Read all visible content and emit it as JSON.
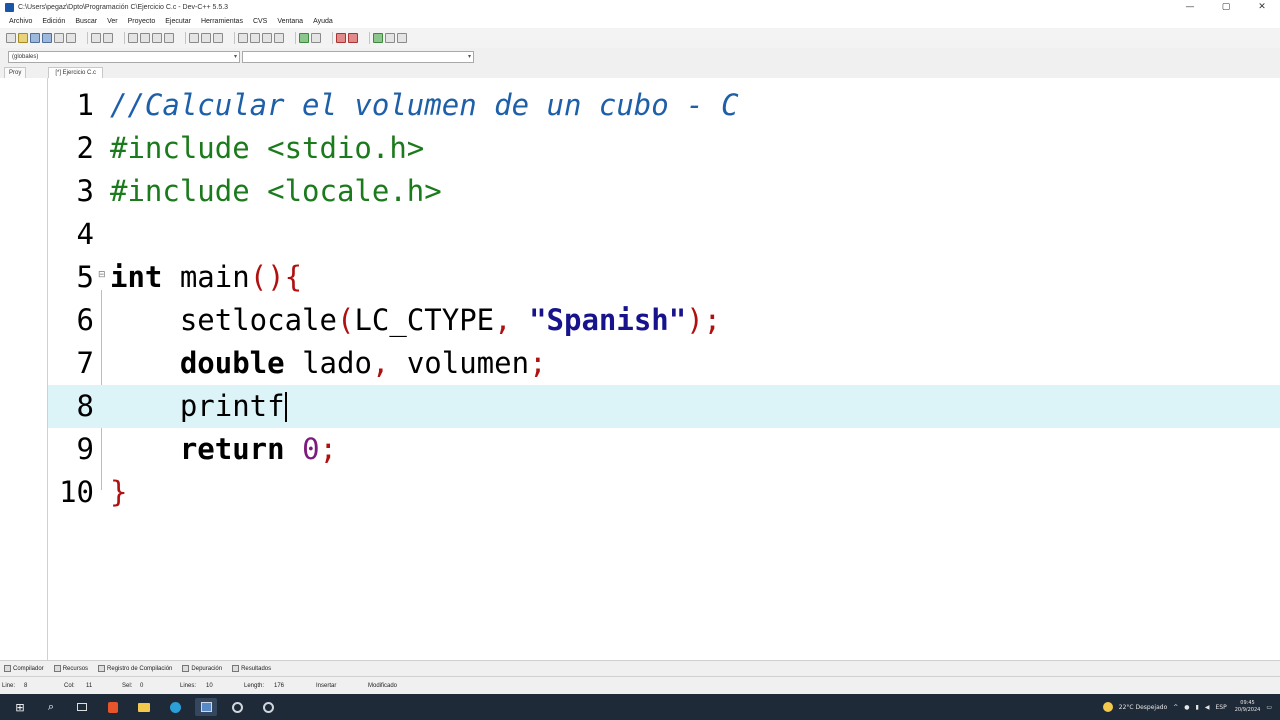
{
  "window": {
    "title": "C:\\Users\\pegaz\\Dpto\\Programación C\\Ejercicio C.c - Dev-C++ 5.5.3",
    "minimize_glyph": "—",
    "maximize_glyph": "▢",
    "close_glyph": "✕"
  },
  "menu": {
    "items": [
      {
        "label": "Archivo"
      },
      {
        "label": "Edición"
      },
      {
        "label": "Buscar"
      },
      {
        "label": "Ver"
      },
      {
        "label": "Proyecto"
      },
      {
        "label": "Ejecutar"
      },
      {
        "label": "Herramientas"
      },
      {
        "label": "CVS"
      },
      {
        "label": "Ventana"
      },
      {
        "label": "Ayuda"
      }
    ]
  },
  "toolbar2": {
    "compiler_select": "(globales)",
    "arrow_glyph": "▾"
  },
  "tabs": {
    "side_tab": "Proy",
    "file_tab": "[*] Ejercicio C.c"
  },
  "editor": {
    "lines": [
      {
        "num": "1"
      },
      {
        "num": "2"
      },
      {
        "num": "3"
      },
      {
        "num": "4"
      },
      {
        "num": "5"
      },
      {
        "num": "6"
      },
      {
        "num": "7"
      },
      {
        "num": "8"
      },
      {
        "num": "9"
      },
      {
        "num": "10"
      }
    ],
    "code": {
      "l1_comment": "//Calcular el volumen de un cubo - C",
      "l2_pre": "#include <stdio.h>",
      "l3_pre": "#include <locale.h>",
      "l5_kw": "int",
      "l5_name": " main",
      "l5_paren": "()",
      "l5_brace": "{",
      "l6_indent": "    ",
      "l6_func": "setlocale",
      "l6_open": "(",
      "l6_arg": "LC_CTYPE",
      "l6_comma": ", ",
      "l6_str": "\"Spanish\"",
      "l6_close": ");",
      "l7_indent": "    ",
      "l7_kw": "double",
      "l7_var1": " lado",
      "l7_comma": ", ",
      "l7_var2": "volumen",
      "l7_semi": ";",
      "l8_indent": "    ",
      "l8_func": "printf",
      "l9_indent": "    ",
      "l9_kw": "return",
      "l9_space": " ",
      "l9_num": "0",
      "l9_semi": ";",
      "l10_brace": "}"
    },
    "fold_glyph": "⊟"
  },
  "bottom_tabs": [
    {
      "label": "Compilador"
    },
    {
      "label": "Recursos"
    },
    {
      "label": "Registro de Compilación"
    },
    {
      "label": "Depuración"
    },
    {
      "label": "Resultados"
    }
  ],
  "status": {
    "line_label": "Line:",
    "line_value": "8",
    "col_label": "Col:",
    "col_value": "11",
    "sel_label": "Sel:",
    "sel_value": "0",
    "lines_label": "Lines:",
    "lines_value": "10",
    "length_label": "Length:",
    "length_value": "176",
    "mode": "Insertar",
    "modified": "Modificado"
  },
  "taskbar": {
    "start_glyph": "⊞",
    "search_glyph": "⌕",
    "weather": "22°C Despejado",
    "lang": "ESP",
    "time": "09:45",
    "date": "20/9/2024"
  }
}
